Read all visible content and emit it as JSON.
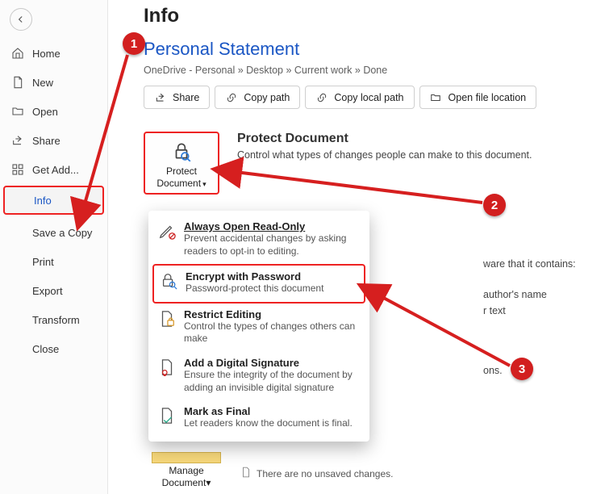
{
  "sidebar": {
    "items": [
      {
        "label": "Home"
      },
      {
        "label": "New"
      },
      {
        "label": "Open"
      },
      {
        "label": "Share"
      },
      {
        "label": "Get Add..."
      },
      {
        "label": "Info"
      },
      {
        "label": "Save a Copy"
      },
      {
        "label": "Print"
      },
      {
        "label": "Export"
      },
      {
        "label": "Transform"
      },
      {
        "label": "Close"
      }
    ]
  },
  "main": {
    "page_title": "Info",
    "doc_title": "Personal Statement",
    "breadcrumb": "OneDrive - Personal » Desktop » Current work » Done",
    "toolbar": {
      "share": "Share",
      "copy_path": "Copy path",
      "copy_local_path": "Copy local path",
      "open_file_location": "Open file location"
    },
    "protect": {
      "button": "Protect Document",
      "heading": "Protect Document",
      "desc": "Control what types of changes people can make to this document."
    },
    "menu": {
      "read_only": {
        "title": "Always Open Read-Only",
        "desc": "Prevent accidental changes by asking readers to opt-in to editing."
      },
      "encrypt": {
        "title": "Encrypt with Password",
        "desc": "Password-protect this document"
      },
      "restrict": {
        "title": "Restrict Editing",
        "desc": "Control the types of changes others can make"
      },
      "signature": {
        "title": "Add a Digital Signature",
        "desc": "Ensure the integrity of the document by adding an invisible digital signature"
      },
      "mark_final": {
        "title": "Mark as Final",
        "desc": "Let readers know the document is final."
      }
    },
    "peek": {
      "line1": "ware that it contains:",
      "line2": "author's name",
      "line3": "r text",
      "line4": "ons."
    },
    "manage": {
      "button": "Manage Document",
      "note": "There are no unsaved changes."
    }
  },
  "callouts": {
    "c1": "1",
    "c2": "2",
    "c3": "3"
  }
}
